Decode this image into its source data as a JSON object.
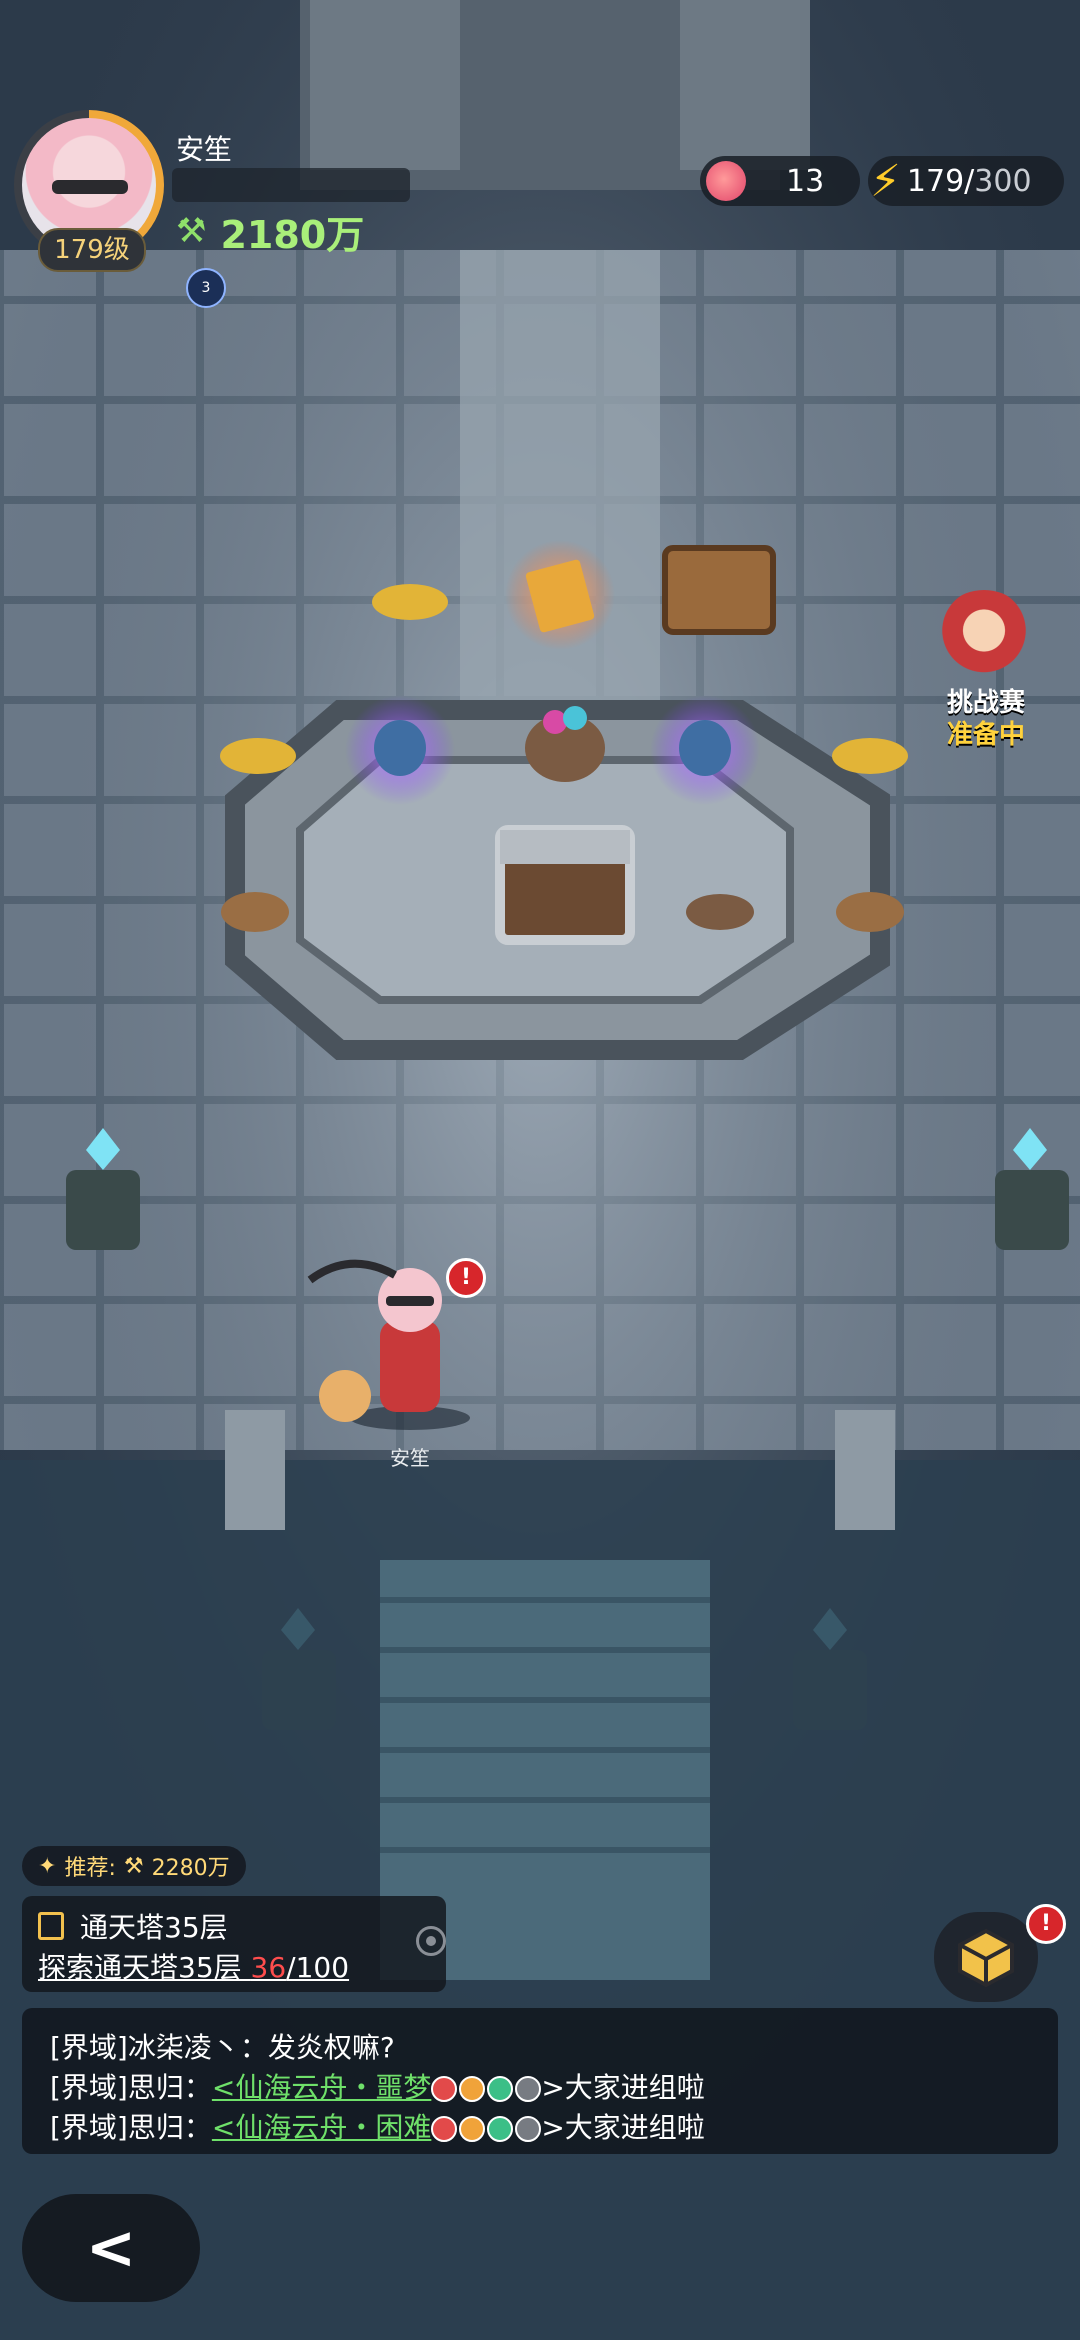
{
  "player": {
    "name": "安笙",
    "level": "179级",
    "power": "2180万",
    "buff_count": "3"
  },
  "resources": {
    "peach_count": "13",
    "stamina": "179/",
    "stamina_max": "300"
  },
  "event": {
    "title": "挑战赛",
    "status": "准备中"
  },
  "character": {
    "name": "安笙",
    "alert": "!"
  },
  "quest": {
    "recommend_label": "推荐:",
    "recommend_power": "2280万",
    "title": "通天塔35层",
    "desc_prefix": "探索通天塔35层 ",
    "progress": "36",
    "total": "/100"
  },
  "bag": {
    "badge": "!"
  },
  "chat": {
    "lines": [
      {
        "channel": "[界域]",
        "text": "冰柒凌丶：发炎权嘛?"
      },
      {
        "channel": "[界域]",
        "text": "思归：",
        "link": "<仙海云舟・噩梦",
        "suffix": ">大家进组啦"
      },
      {
        "channel": "[界域]",
        "text": "思归：",
        "link": "<仙海云舟・困难",
        "suffix": ">大家进组啦"
      }
    ]
  },
  "back": {
    "label": "<"
  }
}
